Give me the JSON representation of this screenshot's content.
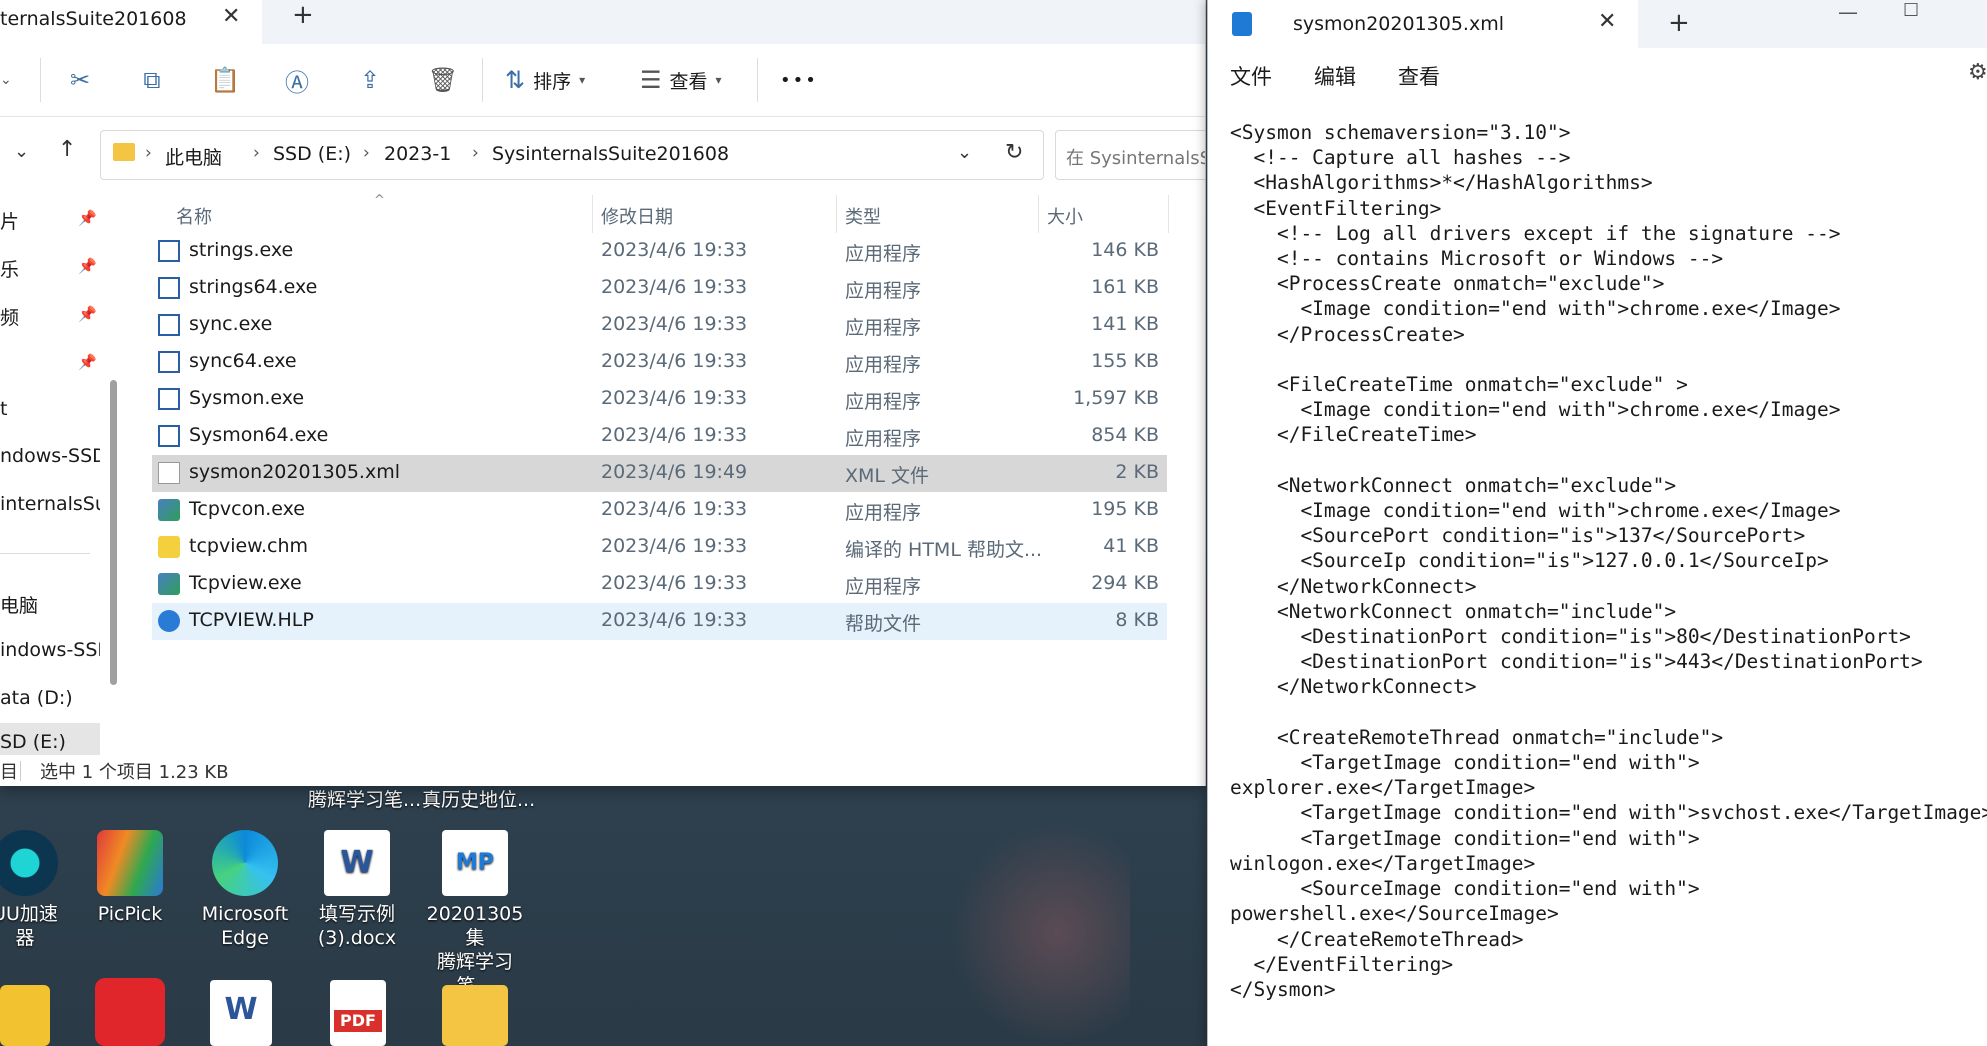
{
  "colors": {
    "selected_row": "#d7d7d7",
    "hover_row": "#e5f1fb",
    "accent": "#3a6ea5"
  },
  "explorer": {
    "tab_title": "ternalsSuite201608",
    "toolbar": {
      "sort_label": "排序",
      "view_label": "查看",
      "more": "•••"
    },
    "breadcrumb": [
      "此电脑",
      "SSD (E:)",
      "2023-1",
      "SysinternalsSuite201608"
    ],
    "search_placeholder": "在 SysinternalsSu",
    "nav_items": [
      "片",
      "乐",
      "频",
      "t",
      "ndows-SSD (",
      "internalsSui",
      "电脑",
      "indows-SSD",
      "ata (D:)",
      "SD (E:)"
    ],
    "columns": {
      "name": "名称",
      "date": "修改日期",
      "type": "类型",
      "size": "大小"
    },
    "files": [
      {
        "name": "strings.exe",
        "date": "2023/4/6 19:33",
        "type": "应用程序",
        "size": "146 KB",
        "icon": "exe-icon"
      },
      {
        "name": "strings64.exe",
        "date": "2023/4/6 19:33",
        "type": "应用程序",
        "size": "161 KB",
        "icon": "exe-icon"
      },
      {
        "name": "sync.exe",
        "date": "2023/4/6 19:33",
        "type": "应用程序",
        "size": "141 KB",
        "icon": "exe-icon"
      },
      {
        "name": "sync64.exe",
        "date": "2023/4/6 19:33",
        "type": "应用程序",
        "size": "155 KB",
        "icon": "exe-icon"
      },
      {
        "name": "Sysmon.exe",
        "date": "2023/4/6 19:33",
        "type": "应用程序",
        "size": "1,597 KB",
        "icon": "exe-icon"
      },
      {
        "name": "Sysmon64.exe",
        "date": "2023/4/6 19:33",
        "type": "应用程序",
        "size": "854 KB",
        "icon": "exe-icon"
      },
      {
        "name": "sysmon20201305.xml",
        "date": "2023/4/6 19:49",
        "type": "XML 文件",
        "size": "2 KB",
        "icon": "xml-file-icon"
      },
      {
        "name": "Tcpvcon.exe",
        "date": "2023/4/6 19:33",
        "type": "应用程序",
        "size": "195 KB",
        "icon": "network-exe-icon"
      },
      {
        "name": "tcpview.chm",
        "date": "2023/4/6 19:33",
        "type": "编译的 HTML 帮助文...",
        "size": "41 KB",
        "icon": "chm-help-icon"
      },
      {
        "name": "Tcpview.exe",
        "date": "2023/4/6 19:33",
        "type": "应用程序",
        "size": "294 KB",
        "icon": "network-exe-icon"
      },
      {
        "name": "TCPVIEW.HLP",
        "date": "2023/4/6 19:33",
        "type": "帮助文件",
        "size": "8 KB",
        "icon": "help-icon"
      }
    ],
    "status": {
      "left": "目",
      "selection": "选中 1 个项目  1.23 KB"
    }
  },
  "desktop": {
    "top_labels": [
      "腾辉学习笔...",
      "真历史地位..."
    ],
    "icons": [
      {
        "label": "UU加速\n器"
      },
      {
        "label": "PicPick"
      },
      {
        "label": "Microsoft\nEdge"
      },
      {
        "label": "填写示例\n(3).docx"
      },
      {
        "label": "20201305集\n腾辉学习笔..."
      }
    ]
  },
  "notepad": {
    "tab_title": "sysmon20201305.xml",
    "menu": [
      "文件",
      "编辑",
      "查看"
    ],
    "content": "<Sysmon schemaversion=\"3.10\">\n  <!-- Capture all hashes -->\n  <HashAlgorithms>*</HashAlgorithms>\n  <EventFiltering>\n    <!-- Log all drivers except if the signature -->\n    <!-- contains Microsoft or Windows -->\n    <ProcessCreate onmatch=\"exclude\">\n      <Image condition=\"end with\">chrome.exe</Image>\n    </ProcessCreate>\n\n    <FileCreateTime onmatch=\"exclude\" >\n      <Image condition=\"end with\">chrome.exe</Image>\n    </FileCreateTime>\n\n    <NetworkConnect onmatch=\"exclude\">\n      <Image condition=\"end with\">chrome.exe</Image>\n      <SourcePort condition=\"is\">137</SourcePort>\n      <SourceIp condition=\"is\">127.0.0.1</SourceIp>\n    </NetworkConnect>\n    <NetworkConnect onmatch=\"include\">\n      <DestinationPort condition=\"is\">80</DestinationPort>\n      <DestinationPort condition=\"is\">443</DestinationPort>\n    </NetworkConnect>\n\n    <CreateRemoteThread onmatch=\"include\">\n      <TargetImage condition=\"end with\">\nexplorer.exe</TargetImage>\n      <TargetImage condition=\"end with\">svchost.exe</TargetImage>\n      <TargetImage condition=\"end with\">\nwinlogon.exe</TargetImage>\n      <SourceImage condition=\"end with\">\npowershell.exe</SourceImage>\n    </CreateRemoteThread>\n  </EventFiltering>\n</Sysmon>"
  }
}
